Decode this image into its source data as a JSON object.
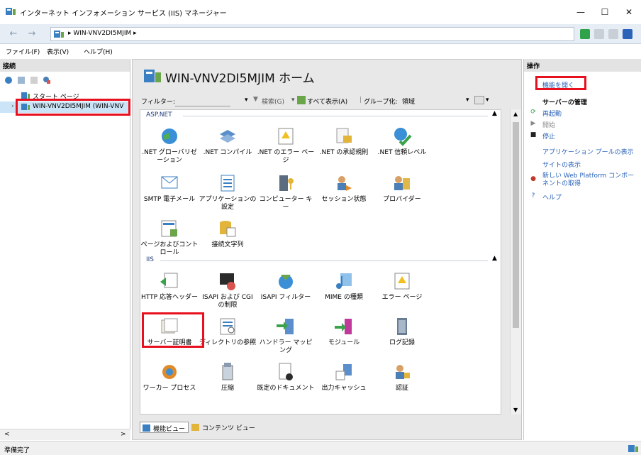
{
  "window": {
    "title": "インターネット インフォメーション サービス (IIS) マネージャー",
    "minimize": "—",
    "maximize": "☐",
    "close": "✕"
  },
  "address": {
    "back": "←",
    "forward": "→",
    "path_text": "▸  WIN-VNV2DI5MJIM  ▸"
  },
  "menu": [
    "ファイル(F)",
    "表示(V)",
    "ヘルプ(H)"
  ],
  "left": {
    "header": "接続",
    "tree": {
      "start_page": "スタート ページ",
      "server": "WIN-VNV2DI5MJIM (WIN-VNV"
    },
    "scroll_left": "<",
    "scroll_right": ">"
  },
  "center": {
    "title": "WIN-VNV2DI5MJIM ホーム",
    "filter_label": "フィルター:",
    "filter_dropdown": "▾",
    "search_btn": "検索(G)",
    "show_all": "すべて表示(A)",
    "group_by_label": "グループ化:",
    "group_by_value": "領域",
    "groups": {
      "aspnet": "ASP.NET",
      "iis": "IIS"
    },
    "features": {
      "aspnet": [
        ".NET グローバリゼーション",
        ".NET コンパイル",
        ".NET のエラー ページ",
        ".NET の承認規則",
        ".NET 信頼レベル",
        "SMTP 電子メール",
        "アプリケーションの設定",
        "コンピューター キー",
        "セッション状態",
        "プロバイダー",
        "ページおよびコントロール",
        "接続文字列"
      ],
      "iis": [
        "HTTP 応答ヘッダー",
        "ISAPI および CGI の制限",
        "ISAPI フィルター",
        "MIME の種類",
        "エラー ページ",
        "サーバー証明書",
        "ディレクトリの参照",
        "ハンドラー マッピング",
        "モジュール",
        "ログ記録",
        "ワーカー プロセス",
        "圧縮",
        "既定のドキュメント",
        "出力キャッシュ",
        "認証"
      ]
    },
    "tabs": {
      "features_view": "機能ビュー",
      "content_view": "コンテンツ ビュー"
    }
  },
  "right": {
    "header": "操作",
    "open_feature": "機能を開く",
    "manage_server": "サーバーの管理",
    "restart": "再起動",
    "start": "開始",
    "stop": "停止",
    "view_app_pools": "アプリケーション プールの表示",
    "view_sites": "サイトの表示",
    "get_wpi": "新しい Web Platform コンポーネントの取得",
    "help": "ヘルプ"
  },
  "status": {
    "text": "準備完了"
  },
  "colors": {
    "highlight": "#e8101e",
    "link": "#2a63b8",
    "selected": "#cce4f7"
  }
}
